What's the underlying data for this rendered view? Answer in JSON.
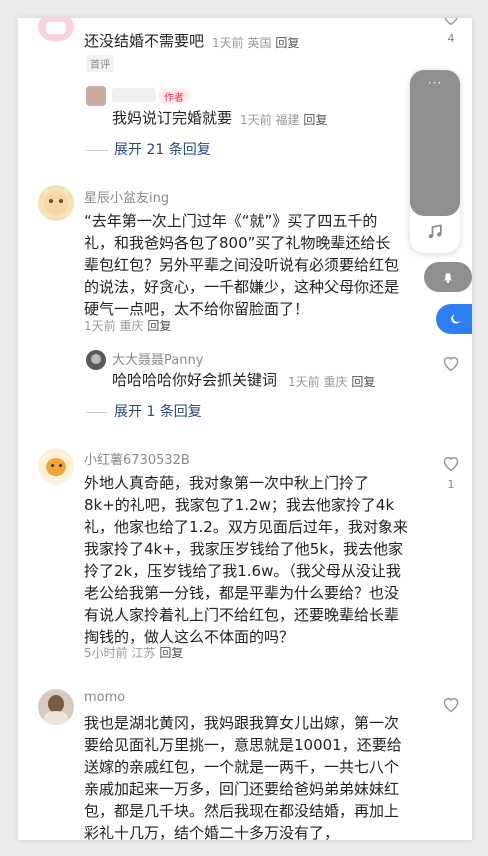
{
  "comment1": {
    "text": "还没结婚不需要吧",
    "time": "1天前",
    "location": "英国",
    "reply": "回复",
    "tag": "首评",
    "likes": "4"
  },
  "reply1": {
    "author_tag": "作者",
    "text": "我妈说订完婚就要",
    "time": "1天前",
    "location": "福建",
    "reply": "回复",
    "expand": "展开 21 条回复"
  },
  "comment2": {
    "user": "星辰小盆友ing",
    "lines": [
      "“去年第一次上门过年《“就”》买了四五千的",
      "礼，和我爸妈各包了800”买了礼物晚辈还给长",
      "辈包红包？另外平辈之间没听说有必须要给红包",
      "的说法，好贪心，一千都嫌少，这种父母你还是",
      "硬气一点吧，太不给你留脸面了！"
    ],
    "time": "1天前",
    "location": "重庆",
    "reply": "回复"
  },
  "reply2": {
    "user": "大大聂聂Panny",
    "text": "哈哈哈哈你好会抓关键词",
    "time": "1天前",
    "location": "重庆",
    "reply": "回复",
    "expand": "展开 1 条回复"
  },
  "comment3": {
    "user": "小红薯6730532B",
    "lines": [
      "外地人真奇葩，我对象第一次中秋上门拎了",
      "8k+的礼吧，我家包了1.2w；我去他家拎了4k",
      "礼，他家也给了1.2。双方见面后过年，我对象来",
      "我家拎了4k+，我家压岁钱给了他5k，我去他家",
      "拎了2k，压岁钱给了我1.6w。（我父母从没让我",
      "老公给我第一分钱，都是平辈为什么要给？也没",
      "有说人家拎着礼上门不给红包，还要晚辈给长辈",
      "掏钱的，做人这么不体面的吗？"
    ],
    "time": "5小时前",
    "location": "江苏",
    "reply": "回复",
    "likes": "1"
  },
  "comment4": {
    "user": "momo",
    "lines": [
      "我也是湖北黄冈，我妈跟我算女儿出嫁，第一次",
      "要给见面礼万里挑一，意思就是10001，还要给",
      "送嫁的亲戚红包，一个就是一两千，一共七八个",
      "亲戚加起来一万多，回门还要给爸妈弟弟妹妹红",
      "包，都是几千块。然后我现在都没结婚，再加上",
      "彩礼十几万，结个婚二十多万没有了，"
    ]
  },
  "float": {
    "more": "···"
  }
}
